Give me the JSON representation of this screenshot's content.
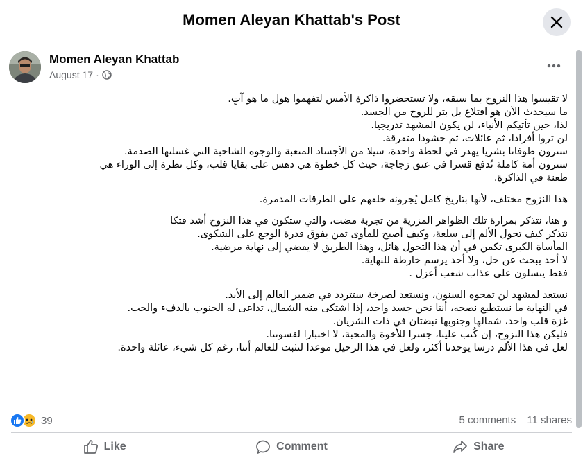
{
  "dialog": {
    "title": "Momen Aleyan Khattab's Post",
    "close_icon": "close-icon"
  },
  "post": {
    "author": "Momen Aleyan Khattab",
    "date": "August 17",
    "separator": "·",
    "privacy_icon": "globe-icon",
    "more_icon": "more-options-icon",
    "paragraphs": [
      {
        "lines": [
          "لا تقيسوا هذا النزوح بما سبقه، ولا تستحضروا ذاكرة الأمس لتفهموا هول ما هو آتٍ.",
          "ما سيحدث الآن هو اقتلاع بل بتر للروح من الجسد.",
          "لذا، حين تأتيكم الأنباء، لن يكون المشهد تدريجيا.",
          "لن تروا أفرادا، ثم عائلات، ثم حشودا متفرقة.",
          "سترون طوفانا بشريا يهدر في لحظة واحدة، سيلا من الأجساد المتعبة والوجوه الشاحبة التي غسلتها الصدمة.",
          "سترون أمة كاملة تُدفع قسرا في عنق زجاجة، حيث كل خطوة هي دهس على بقايا قلب، وكل نظرة إلى الوراء هي",
          "طعنة في الذاكرة."
        ]
      },
      {
        "lines": [
          "هذا النزوح مختلف، لأنها بتاريخ كامل يُجرونه خلفهم على الطرقات المدمرة."
        ]
      },
      {
        "lines": [
          "و هنا، نتذكر بمرارة تلك الظواهر المزرية من تجربة مضت، والتي ستكون في هذا النزوح أشد فتكا",
          "نتذكر كيف تحول الألم إلى سلعة، وكيف أصبح للمأوى ثمن يفوق قدرة الوجع على الشكوى.",
          "المأساة الكبرى تكمن في أن هذا التحول هائل، وهذا الطريق لا يفضي إلى نهاية مرضية.",
          "لا أحد يبحث عن حل، ولا أحد يرسم خارطة للنهاية.",
          "فقط يتسلون على عذاب شعب أعزل ."
        ]
      },
      {
        "lines": [
          "نستعد لمشهد لن تمحوه السنون، ونستعد لصرخة ستتردد في ضمير العالم إلى الأبد.",
          "في النهاية ما نستطيع نصحه، أننا نحن جسد واحد، إذا اشتكى منه الشمال، تداعى له الجنوب بالدفء والحب.",
          "غزة قلب واحد، شمالها وجنوبها نبضتان في ذات الشريان.",
          "فليكن هذا النزوح، إن كُتب علينا، جسرا للأخوة والمحبة، لا اختبارا لقسوتنا.",
          "لعل في هذا الألم درسا يوحدنا أكثر، ولعل في هذا الرحيل موعدا لنثبت للعالم أننا، رغم كل شيء، عائلة واحدة."
        ]
      }
    ]
  },
  "engagement": {
    "reaction_icons": [
      "like-reaction-icon",
      "sad-reaction-icon"
    ],
    "reaction_count": "39",
    "comments": "5 comments",
    "shares": "11 shares"
  },
  "actions": {
    "like": "Like",
    "comment": "Comment",
    "share": "Share"
  },
  "colors": {
    "brand_blue": "#1877f2",
    "sad_yellow": "#f7b928",
    "secondary_text": "#65676b",
    "close_button_bg": "#e4e6eb"
  }
}
